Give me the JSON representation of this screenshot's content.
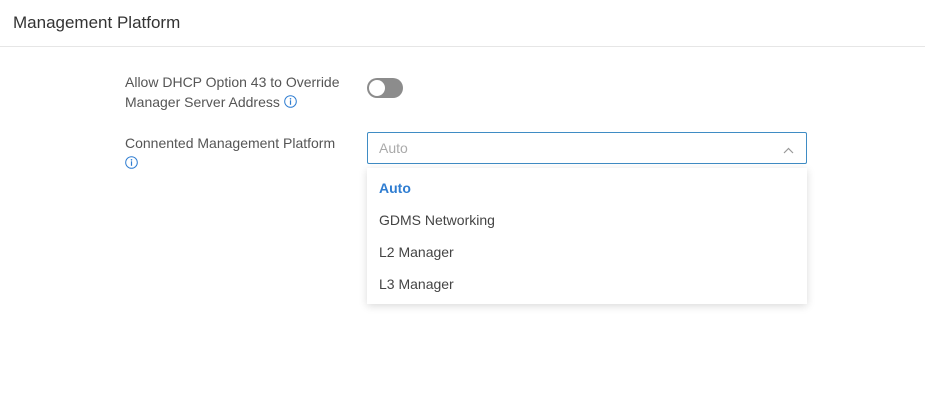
{
  "section": {
    "title": "Management Platform"
  },
  "dhcp_override": {
    "label_line1": "Allow DHCP Option 43 to Override",
    "label_line2": "Manager Server Address",
    "enabled": false
  },
  "platform": {
    "label": "Connented Management Platform",
    "selected_value": "Auto",
    "options": [
      "Auto",
      "GDMS Networking",
      "L2 Manager",
      "L3 Manager"
    ]
  },
  "colors": {
    "accent": "#2f7dd1",
    "select_border": "#3f8cc4",
    "toggle_off": "#8c8c8c"
  }
}
